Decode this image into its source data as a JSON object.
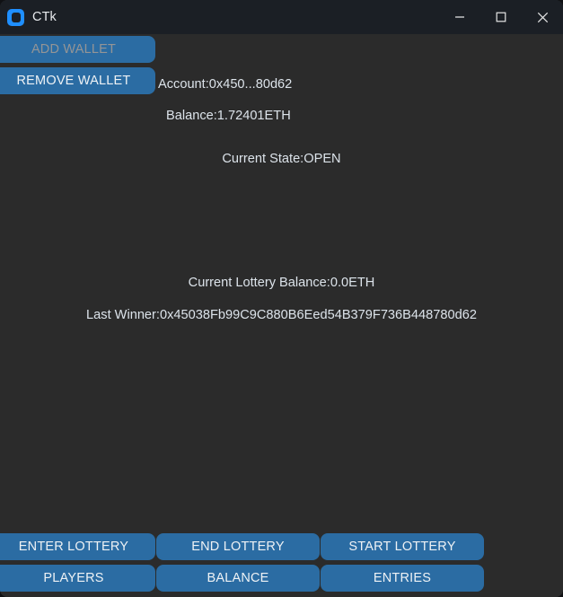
{
  "window": {
    "title": "CTk",
    "icon": "app-logo-icon",
    "controls": {
      "minimize": "minimize-icon",
      "maximize": "maximize-icon",
      "close": "close-icon"
    }
  },
  "colors": {
    "window_background": "#2b2b2b",
    "title_bar_background": "#1b1f25",
    "button_blue": "#2b6ca3",
    "text_primary": "#dce3ea",
    "text_disabled": "#949596",
    "accent_logo": "#1f8fff"
  },
  "wallet": {
    "add_wallet_label": "ADD WALLET",
    "add_wallet_disabled": true,
    "remove_wallet_label": "REMOVE WALLET",
    "account_label": "Account:0x450...80d62",
    "balance_label": "Balance:1.72401ETH"
  },
  "status": {
    "state_label": "Current State:OPEN",
    "lottery_balance_label": "Current Lottery Balance:0.0ETH",
    "last_winner_label": "Last Winner:0x45038Fb99C9C880B6Eed54B379F736B448780d62"
  },
  "actions": {
    "buttons": [
      {
        "label": "ENTER LOTTERY",
        "name": "enter-lottery-button"
      },
      {
        "label": "END LOTTERY",
        "name": "end-lottery-button"
      },
      {
        "label": "START LOTTERY",
        "name": "start-lottery-button"
      },
      {
        "label": "PLAYERS",
        "name": "players-button"
      },
      {
        "label": "BALANCE",
        "name": "balance-button"
      },
      {
        "label": "ENTRIES",
        "name": "entries-button"
      }
    ]
  }
}
